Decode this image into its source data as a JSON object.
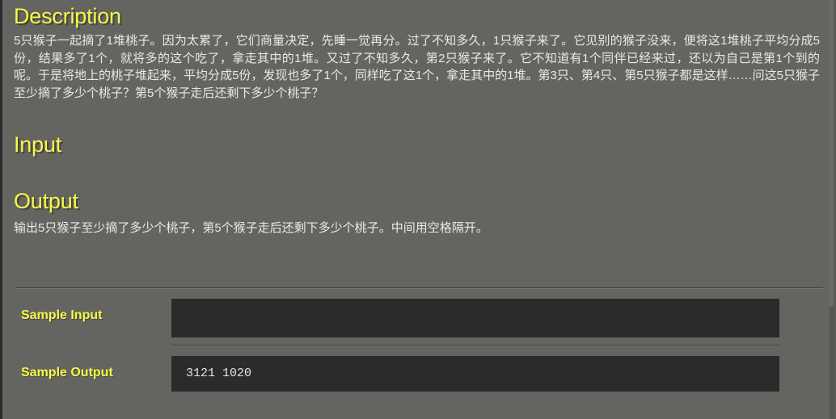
{
  "page": {
    "background_color": "#646560",
    "heading_color": "#f7f74a",
    "body_text_color": "#e9e9e7",
    "code_box_color": "#2b2b2b"
  },
  "sections": {
    "description": {
      "title": "Description",
      "text": "5只猴子一起摘了1堆桃子。因为太累了，它们商量决定，先睡一觉再分。过了不知多久，1只猴子来了。它见别的猴子没来，便将这1堆桃子平均分成5份，结果多了1个，就将多的这个吃了，拿走其中的1堆。又过了不知多久，第2只猴子来了。它不知道有1个同伴已经来过，还以为自己是第1个到的呢。于是将地上的桃子堆起来，平均分成5份，发现也多了1个，同样吃了这1个，拿走其中的1堆。第3只、第4只、第5只猴子都是这样……问这5只猴子至少摘了多少个桃子？第5个猴子走后还剩下多少个桃子？"
    },
    "input": {
      "title": "Input",
      "text": ""
    },
    "output": {
      "title": "Output",
      "text": "输出5只猴子至少摘了多少个桃子，第5个猴子走后还剩下多少个桃子。中间用空格隔开。"
    }
  },
  "samples": {
    "input_label": "Sample Input",
    "input_value": "",
    "output_label": "Sample Output",
    "output_value": "3121 1020"
  }
}
